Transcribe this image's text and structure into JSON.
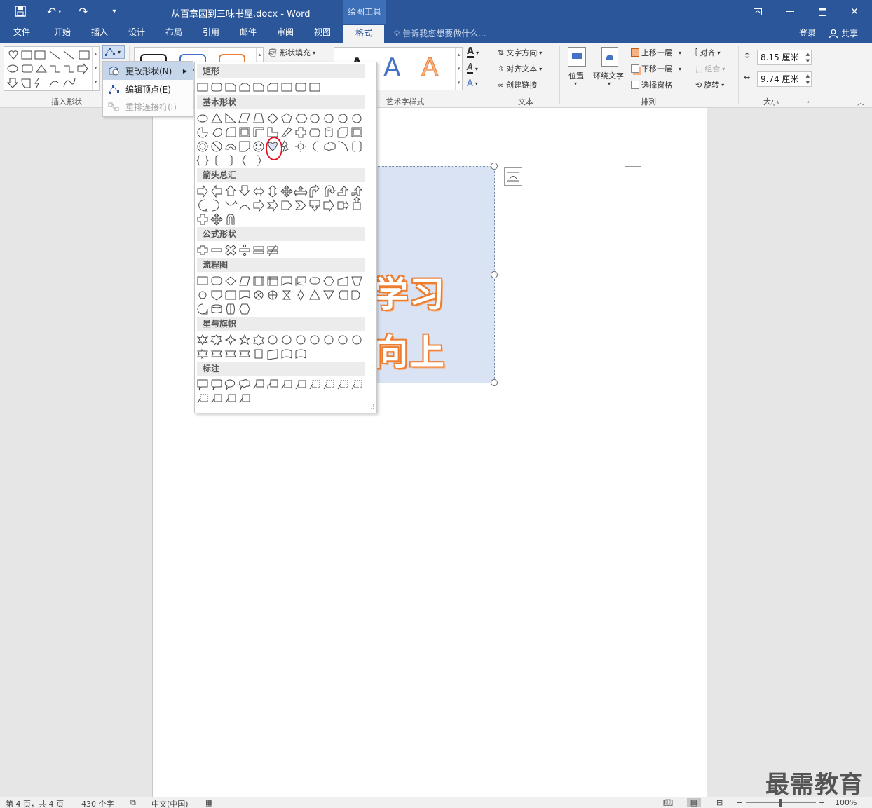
{
  "title_bar": {
    "title": "从百章园到三味书屋.docx - Word",
    "context_tab": "绘图工具",
    "save_icon": "save-icon",
    "undo_icon": "undo-icon",
    "redo_icon": "redo-icon",
    "customize_icon": "customize-qat-icon"
  },
  "tabs": [
    {
      "label": "文件"
    },
    {
      "label": "开始"
    },
    {
      "label": "插入"
    },
    {
      "label": "设计"
    },
    {
      "label": "布局"
    },
    {
      "label": "引用"
    },
    {
      "label": "邮件"
    },
    {
      "label": "审阅"
    },
    {
      "label": "视图"
    },
    {
      "label": "格式"
    }
  ],
  "tell_me": "告诉我您想要做什么...",
  "login": "登录",
  "share": "共享",
  "ribbon": {
    "insert_shapes_label": "插入形状",
    "shape_fill": "形状填充",
    "wordart_label": "艺术字样式",
    "text_direction": "文字方向",
    "align_text": "对齐文本",
    "create_link": "创建链接",
    "text_label": "文本",
    "position": "位置",
    "wrap_text": "环绕文字",
    "bring_forward": "上移一层",
    "send_backward": "下移一层",
    "selection_pane": "选择窗格",
    "align": "对齐",
    "group": "组合",
    "rotate": "旋转",
    "arrange_label": "排列",
    "height": "8.15 厘米",
    "width": "9.74 厘米",
    "size_label": "大小"
  },
  "submenu": {
    "change_shape": "更改形状(N)",
    "edit_points": "编辑顶点(E)",
    "reroute": "重排连接符(I)"
  },
  "shape_panel": {
    "categories": [
      {
        "title": "矩形"
      },
      {
        "title": "基本形状"
      },
      {
        "title": "箭头总汇"
      },
      {
        "title": "公式形状"
      },
      {
        "title": "流程图"
      },
      {
        "title": "星与旗帜"
      },
      {
        "title": "标注"
      }
    ]
  },
  "document": {
    "line1": "学习",
    "line2": "向上"
  },
  "status_bar": {
    "page": "第 4 页，共 4 页",
    "words": "430 个字",
    "language": "中文(中国)",
    "zoom": "100%"
  },
  "watermark": "最需教育",
  "colors": {
    "brand": "#2b579a",
    "wordart_orange": "#ed7d31",
    "wordart_blue": "#4472c4",
    "highlight_red": "#e81123"
  }
}
